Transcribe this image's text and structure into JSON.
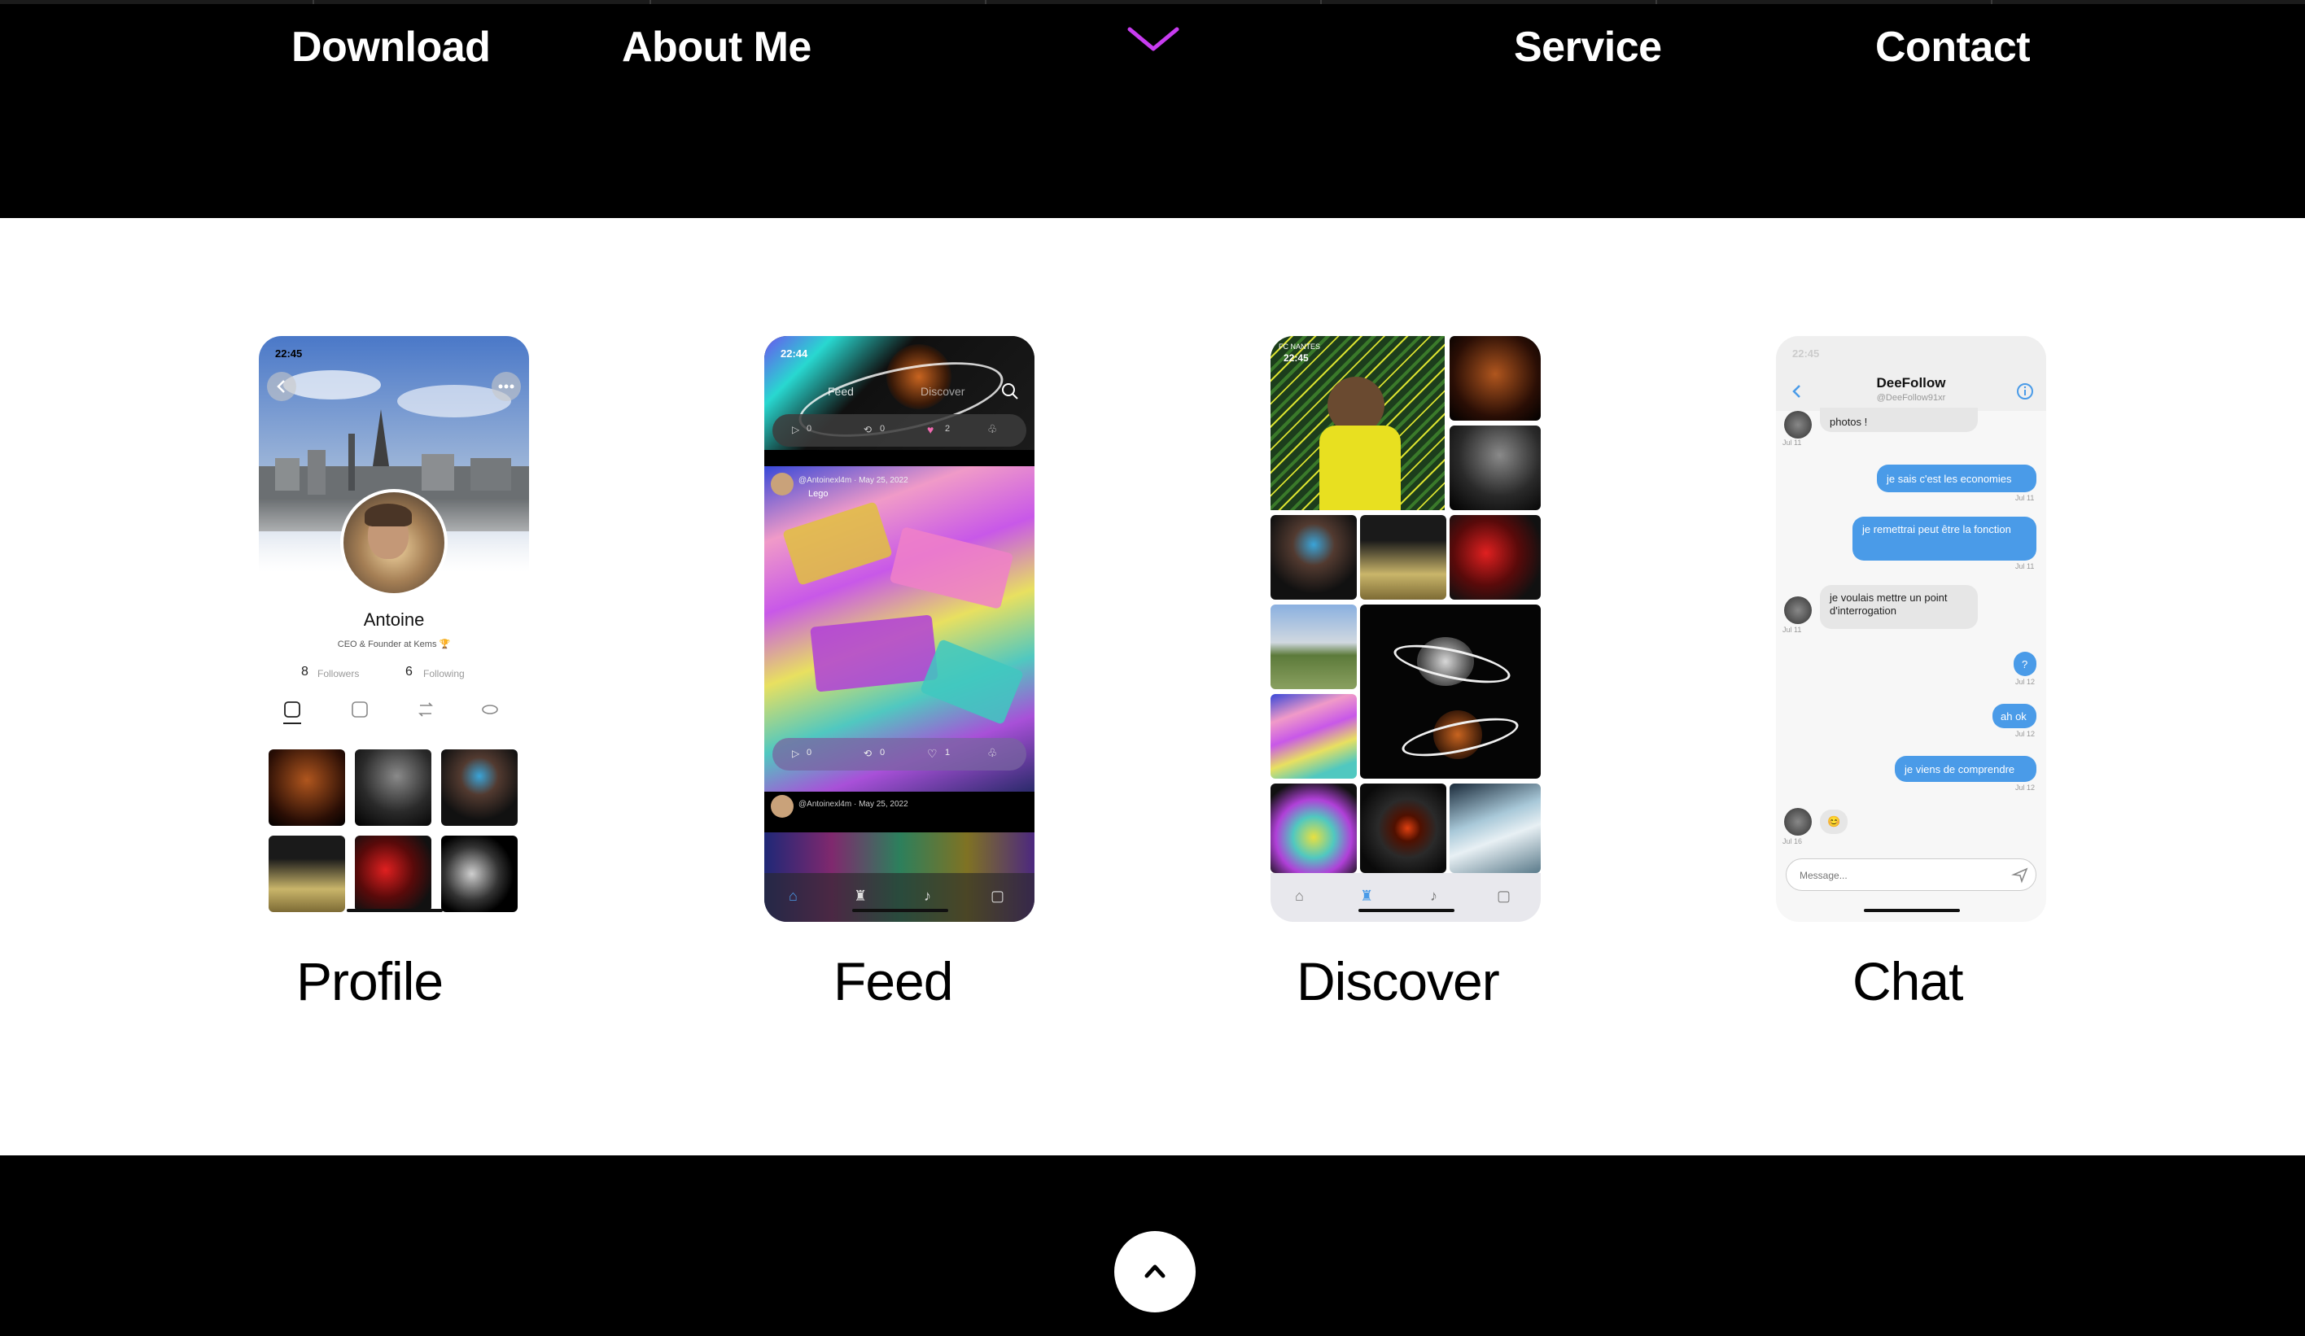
{
  "nav": {
    "download": "Download",
    "about": "About Me",
    "service": "Service",
    "contact": "Contact"
  },
  "logo_icon": "double-chevron-logo-icon",
  "screens": [
    {
      "label": "Profile"
    },
    {
      "label": "Feed"
    },
    {
      "label": "Discover"
    },
    {
      "label": "Chat"
    }
  ],
  "profile": {
    "time": "22:45",
    "name": "Antoine",
    "bio": "CEO & Founder at Kems 🏆",
    "followers_count": "8",
    "followers_label": "Followers",
    "following_count": "6",
    "following_label": "Following"
  },
  "feed": {
    "time": "22:44",
    "tab_feed": "Feed",
    "tab_discover": "Discover",
    "post1_user": "@Antoinexl4m · May 25, 2022",
    "post1_text": "Lego",
    "post2_user": "@Antoinexl4m · May 25, 2022",
    "stats_top": [
      "0",
      "0",
      "2"
    ],
    "stats_bottom": [
      "0",
      "0",
      "1"
    ]
  },
  "discover": {
    "time": "22:45",
    "brand": "FC NANTES"
  },
  "chat": {
    "time": "22:45",
    "contact_name": "DeeFollow",
    "contact_handle": "@DeeFollow91xr",
    "messages": [
      {
        "text": "photos !",
        "side": "left",
        "date": "Jul 11"
      },
      {
        "text": "je sais c'est les economies",
        "side": "right",
        "date": "Jul 11"
      },
      {
        "text": "je remettrai peut être la fonction",
        "side": "right",
        "date": "Jul 11"
      },
      {
        "text": "je voulais mettre un point d'interrogation",
        "side": "left",
        "date": "Jul 11"
      },
      {
        "text": "?",
        "side": "right",
        "date": "Jul 12"
      },
      {
        "text": "ah ok",
        "side": "right",
        "date": "Jul 12"
      },
      {
        "text": "je viens de comprendre",
        "side": "right",
        "date": "Jul 12"
      },
      {
        "text": "😊",
        "side": "left",
        "date": "Jul 16"
      }
    ],
    "input_placeholder": "Message..."
  },
  "footer": {
    "scroll_top_icon": "chevron-up-icon"
  },
  "colors": {
    "header_bg": "#000000",
    "accent_blue": "#4a9be8",
    "logo_magenta": "#c83cf0",
    "logo_cyan": "#38d8f0",
    "logo_yellow": "#f0d840"
  }
}
